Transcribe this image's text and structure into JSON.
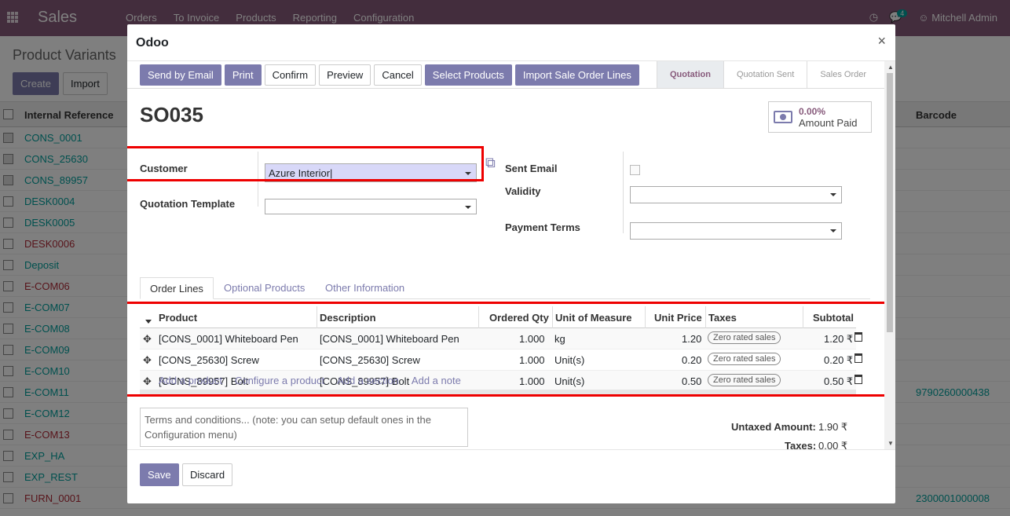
{
  "topbar": {
    "app_name": "Sales",
    "menu": [
      "Orders",
      "To Invoice",
      "Products",
      "Reporting",
      "Configuration"
    ],
    "messages_count": "4",
    "user_name": "Mitchell Admin"
  },
  "control_panel": {
    "title": "Product Variants",
    "create_label": "Create",
    "import_label": "Import"
  },
  "list": {
    "header_ref": "Internal Reference",
    "header_barcode": "Barcode",
    "rows": [
      {
        "ref": "CONS_0001",
        "barcode": "",
        "checked": true
      },
      {
        "ref": "CONS_25630",
        "barcode": "",
        "checked": true
      },
      {
        "ref": "CONS_89957",
        "barcode": "",
        "checked": true
      },
      {
        "ref": "DESK0004",
        "barcode": "",
        "checked": false
      },
      {
        "ref": "DESK0005",
        "barcode": "",
        "checked": false
      },
      {
        "ref": "DESK0006",
        "barcode": "",
        "checked": false
      },
      {
        "ref": "Deposit",
        "barcode": "",
        "checked": false
      },
      {
        "ref": "E-COM06",
        "barcode": "",
        "checked": false
      },
      {
        "ref": "E-COM07",
        "barcode": "",
        "checked": false
      },
      {
        "ref": "E-COM08",
        "barcode": "",
        "checked": false
      },
      {
        "ref": "E-COM09",
        "barcode": "",
        "checked": false
      },
      {
        "ref": "E-COM10",
        "barcode": "",
        "checked": false
      },
      {
        "ref": "E-COM11",
        "barcode": "9790260000438",
        "checked": false
      },
      {
        "ref": "E-COM12",
        "barcode": "",
        "checked": false
      },
      {
        "ref": "E-COM13",
        "barcode": "",
        "checked": false
      },
      {
        "ref": "EXP_HA",
        "barcode": "",
        "checked": false
      },
      {
        "ref": "EXP_REST",
        "barcode": "",
        "checked": false
      },
      {
        "ref": "FURN_0001",
        "barcode": "2300001000008",
        "checked": false
      }
    ]
  },
  "modal": {
    "title": "Odoo",
    "close": "×",
    "buttons": {
      "send_by_email": "Send by Email",
      "print": "Print",
      "confirm": "Confirm",
      "preview": "Preview",
      "cancel": "Cancel",
      "select_products": "Select Products",
      "import_lines": "Import Sale Order Lines"
    },
    "steps": [
      "Quotation",
      "Quotation Sent",
      "Sales Order"
    ],
    "order_name": "SO035",
    "amount_paid_value": "0.00%",
    "amount_paid_label": "Amount Paid",
    "fields": {
      "customer_label": "Customer",
      "customer_value": "Azure Interior",
      "template_label": "Quotation Template",
      "template_value": "",
      "sent_email_label": "Sent Email",
      "validity_label": "Validity",
      "validity_value": "",
      "payment_terms_label": "Payment Terms",
      "payment_terms_value": ""
    },
    "tabs": [
      "Order Lines",
      "Optional Products",
      "Other Information"
    ],
    "table": {
      "headers": {
        "product": "Product",
        "description": "Description",
        "qty": "Ordered Qty",
        "uom": "Unit of Measure",
        "price": "Unit Price",
        "taxes": "Taxes",
        "subtotal": "Subtotal"
      },
      "rows": [
        {
          "product": "[CONS_0001] Whiteboard Pen",
          "description": "[CONS_0001] Whiteboard Pen",
          "qty": "1.000",
          "uom": "kg",
          "price": "1.20",
          "tax": "Zero rated sales",
          "subtotal": "1.20 ₹"
        },
        {
          "product": "[CONS_25630] Screw",
          "description": "[CONS_25630] Screw",
          "qty": "1.000",
          "uom": "Unit(s)",
          "price": "0.20",
          "tax": "Zero rated sales",
          "subtotal": "0.20 ₹"
        },
        {
          "product": "[CONS_89957] Bolt",
          "description": "[CONS_89957] Bolt",
          "qty": "1.000",
          "uom": "Unit(s)",
          "price": "0.50",
          "tax": "Zero rated sales",
          "subtotal": "0.50 ₹"
        }
      ],
      "add_links": [
        "Add a product",
        "Configure a product",
        "Add a section",
        "Add a note"
      ]
    },
    "terms_placeholder": "Terms and conditions... (note: you can setup default ones in the Configuration menu)",
    "totals": {
      "untaxed_label": "Untaxed Amount:",
      "untaxed_value": "1.90 ₹",
      "taxes_label": "Taxes:",
      "taxes_value": "0.00 ₹"
    },
    "footer": {
      "save": "Save",
      "discard": "Discard"
    }
  }
}
